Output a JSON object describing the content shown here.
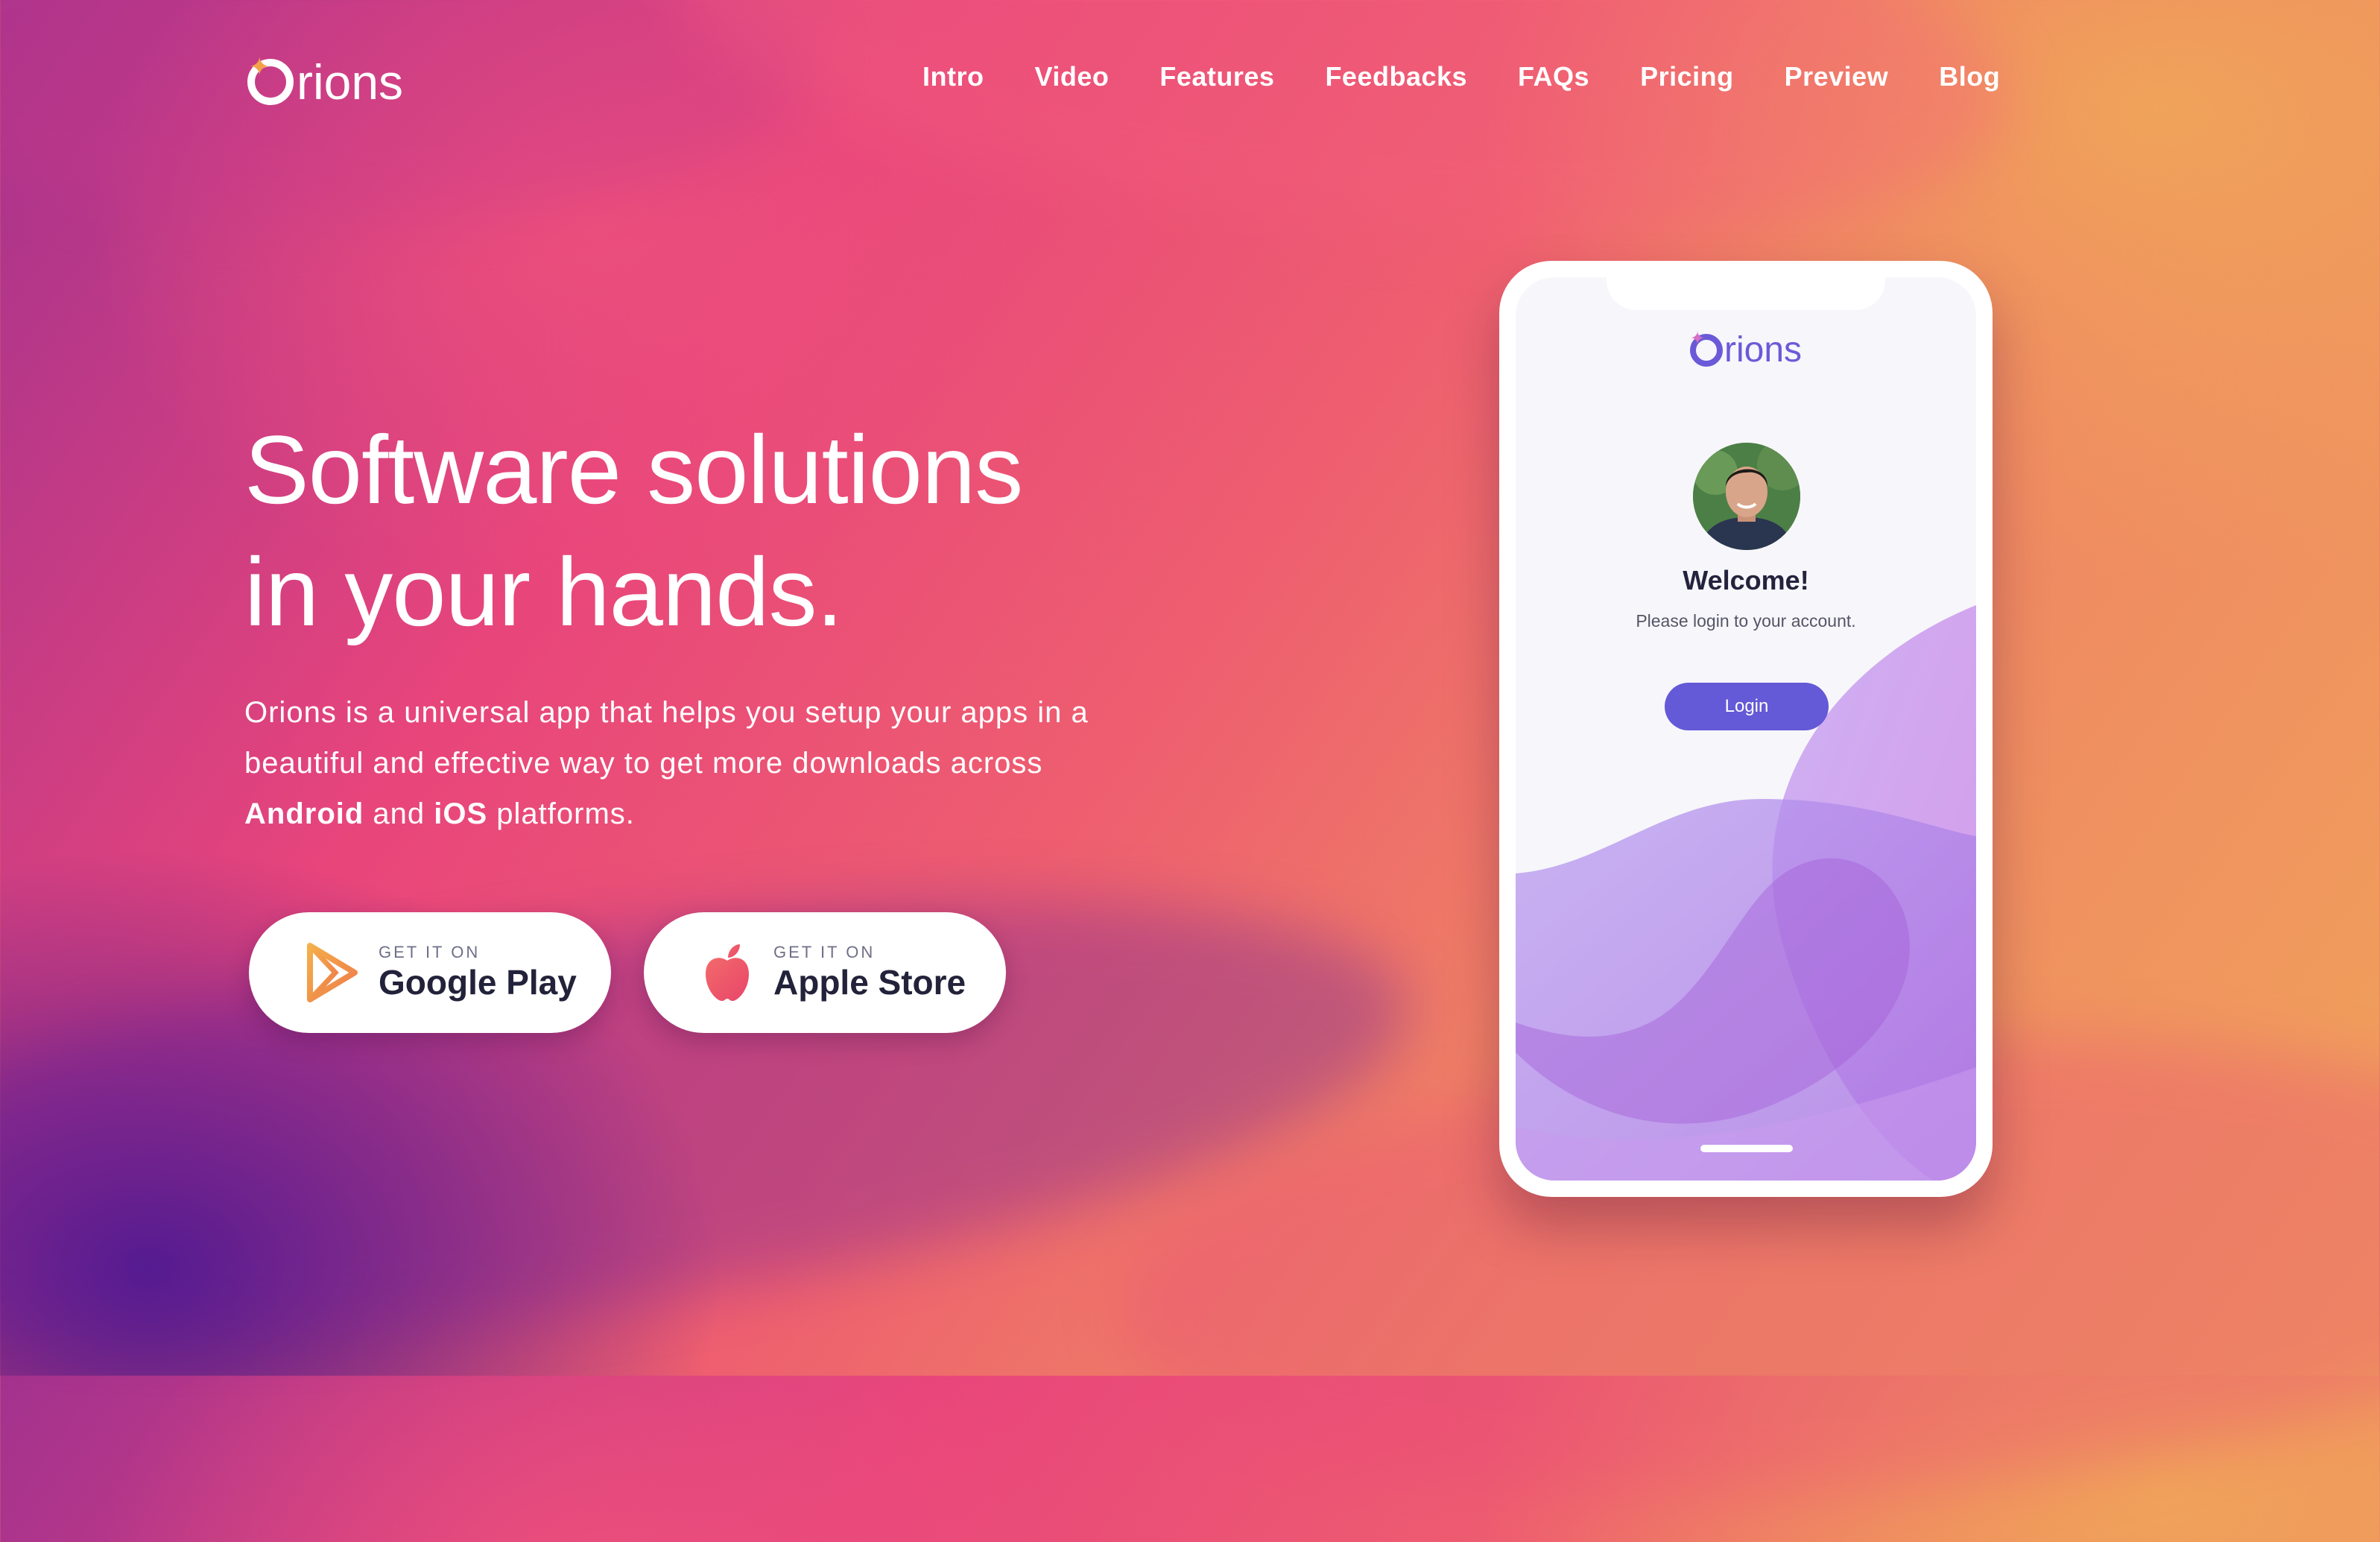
{
  "brand": {
    "name": "rions",
    "accent": "#f4a24a"
  },
  "nav": {
    "items": [
      "Intro",
      "Video",
      "Features",
      "Feedbacks",
      "FAQs",
      "Pricing",
      "Preview",
      "Blog"
    ]
  },
  "hero": {
    "headline_line1": "Software solutions",
    "headline_line2": "in your hands.",
    "desc_part1": "Orions is a universal app that helps you setup your apps in a beautiful and effective way to get more downloads across ",
    "desc_bold1": "Android",
    "desc_part2": " and ",
    "desc_bold2": "iOS",
    "desc_part3": " platforms."
  },
  "store_buttons": {
    "google": {
      "small": "GET IT ON",
      "big": "Google Play",
      "icon": "google-play-icon"
    },
    "apple": {
      "small": "GET IT ON",
      "big": "Apple Store",
      "icon": "apple-icon"
    }
  },
  "phone": {
    "logo_text": "rions",
    "welcome": "Welcome!",
    "subtitle": "Please login to your account.",
    "login_label": "Login",
    "accent": "#6459d6"
  }
}
